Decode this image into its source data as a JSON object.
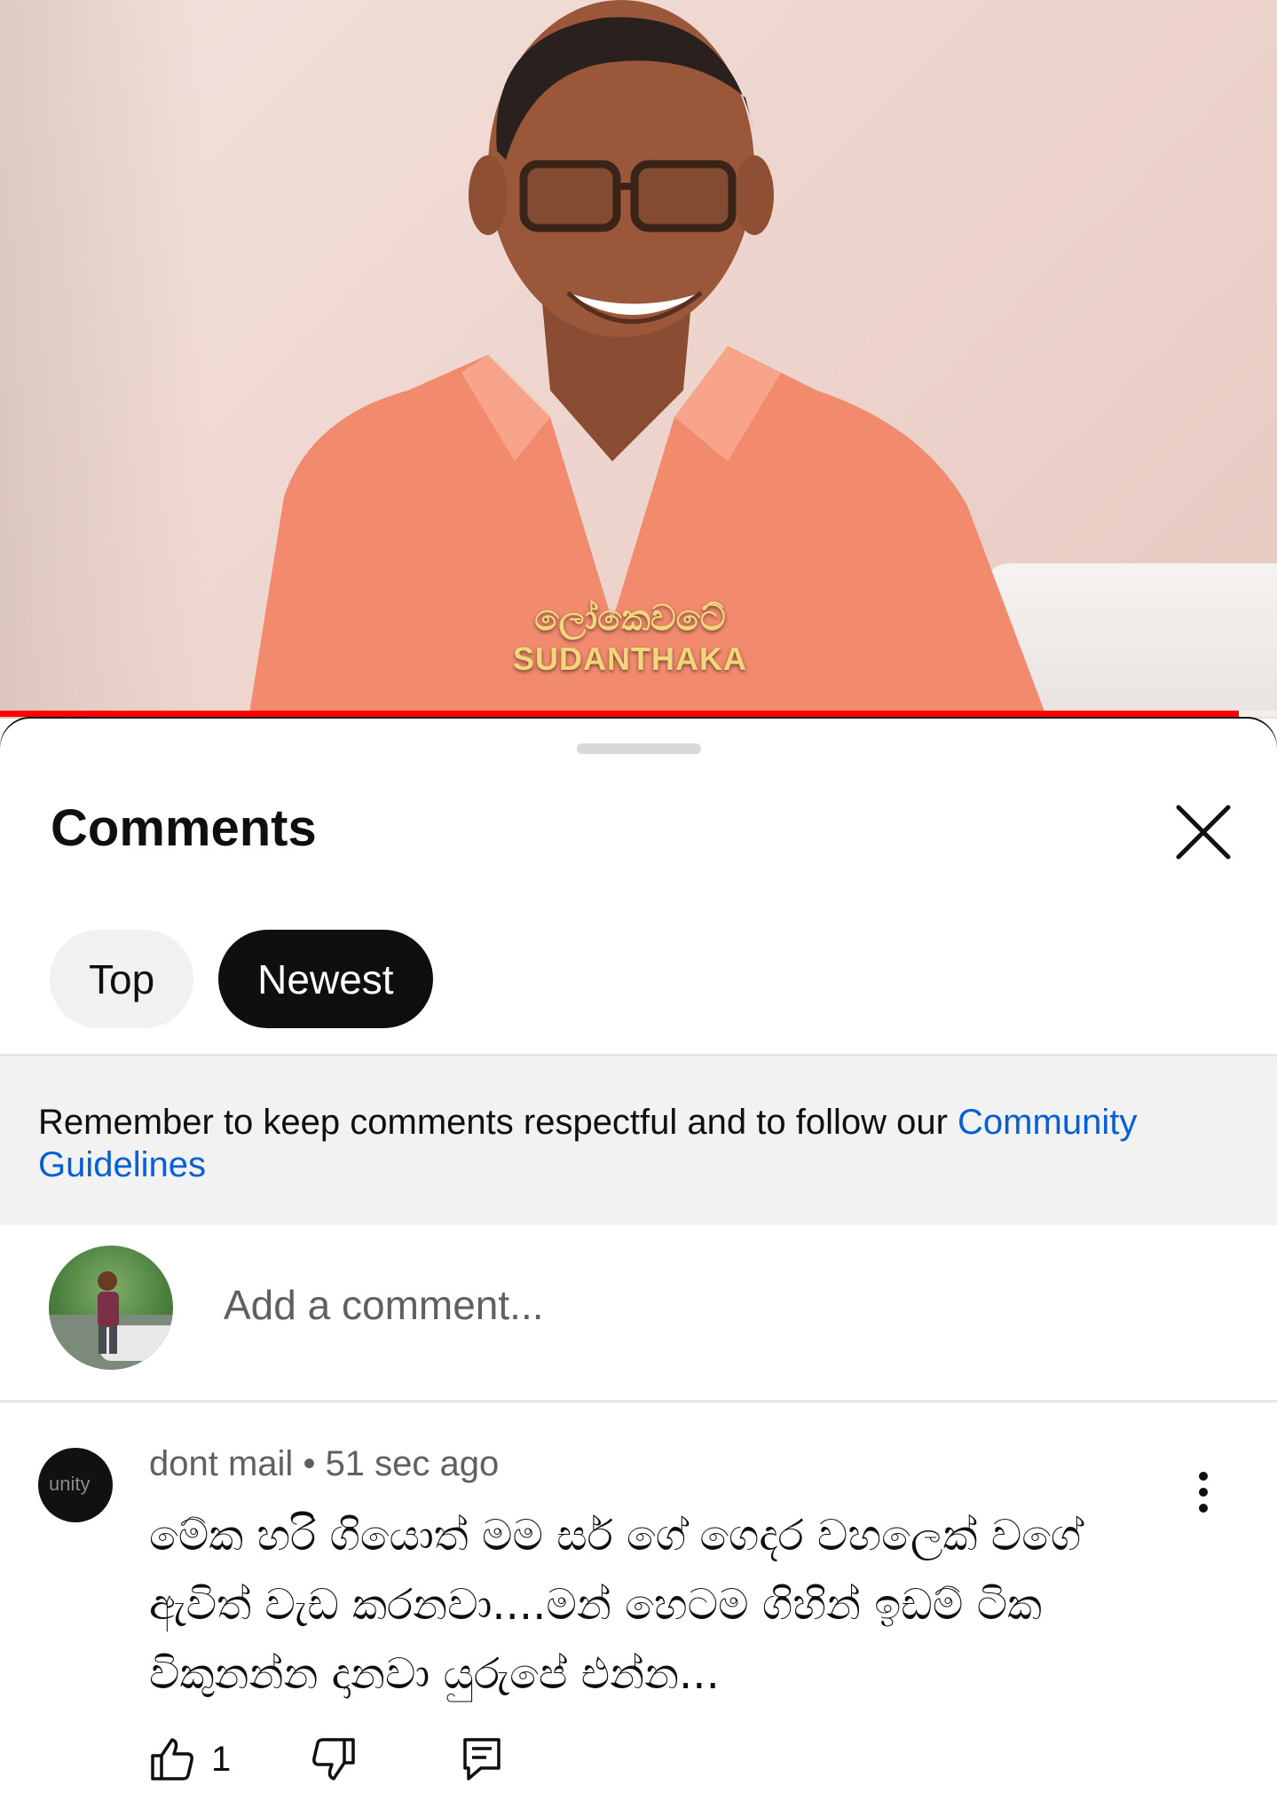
{
  "video": {
    "overlay_sinhala": "ලෝකෙවටේ",
    "overlay_latin": "SUDANTHAKA",
    "progress": 0.97,
    "progress_color": "#ff0000"
  },
  "sheet": {
    "title": "Comments",
    "close_icon": "close-icon",
    "chips": [
      {
        "label": "Top",
        "active": false
      },
      {
        "label": "Newest",
        "active": true
      }
    ]
  },
  "guidelines": {
    "text": "Remember to keep comments respectful and to follow our ",
    "link": "Community Guidelines"
  },
  "composer": {
    "placeholder": "Add a comment..."
  },
  "comments": [
    {
      "author": "dont mail",
      "time": "51 sec ago",
      "avatar_text": "unity",
      "text": "මේක හරි ගියොත් මම සර් ගේ ගෙදර වහලෙක් වගේ ඇවිත් වැඩ කරනවා....මන් හෙටම ගිහින් ඉඩම් ටික විකුනන්න දානවා යුරුපේ එන්න...",
      "likes": "1"
    }
  ],
  "colors": {
    "link": "#065fd4",
    "chip_active_bg": "#0f0f0f",
    "chip_inactive_bg": "#f1f1f1",
    "guideline_bg": "#f2f2f2"
  }
}
